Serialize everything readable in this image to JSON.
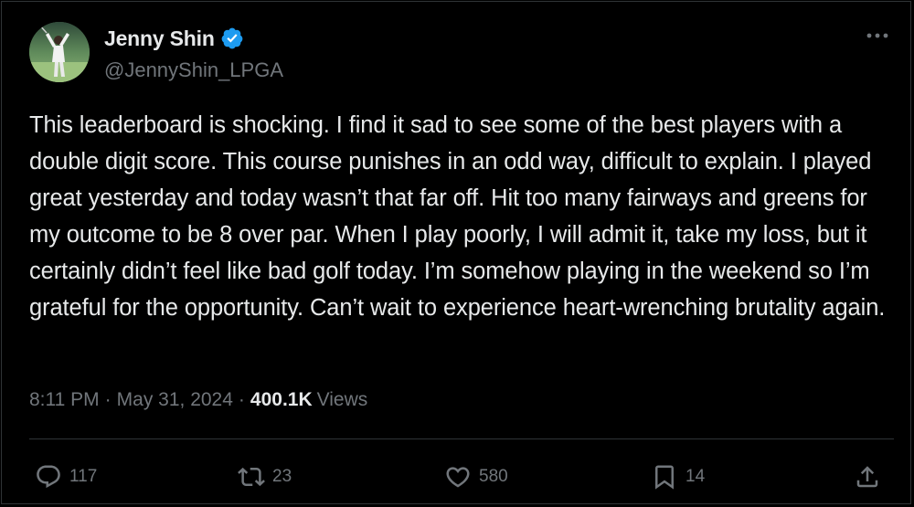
{
  "author": {
    "display_name": "Jenny Shin",
    "handle": "@JennyShin_LPGA",
    "verified": true,
    "verified_color": "#1d9bf0"
  },
  "tweet": {
    "text": "This leaderboard is shocking. I find it sad to see some of the best players with a double digit score. This course punishes in an odd way, difficult to explain. I played great yesterday and today wasn’t that far off. Hit too many fairways and greens for my outcome to be 8 over par. When I play poorly, I will admit it, take my loss, but it certainly didn’t feel like bad golf today. I’m somehow playing in the weekend so I’m grateful for the opportunity. Can’t wait to experience heart-wrenching brutality again."
  },
  "meta": {
    "time": "8:11 PM",
    "separator": "·",
    "date": "May 31, 2024",
    "views_count": "400.1K",
    "views_label": "Views"
  },
  "actions": {
    "replies": "117",
    "reposts": "23",
    "likes": "580",
    "bookmarks": "14"
  },
  "icons": {
    "more": "more-horizontal-icon",
    "reply": "reply-icon",
    "repost": "repost-icon",
    "like": "heart-icon",
    "bookmark": "bookmark-icon",
    "share": "share-icon"
  },
  "colors": {
    "background": "#000000",
    "text_primary": "#e7e9ea",
    "text_secondary": "#71767b",
    "divider": "#2f3336"
  }
}
